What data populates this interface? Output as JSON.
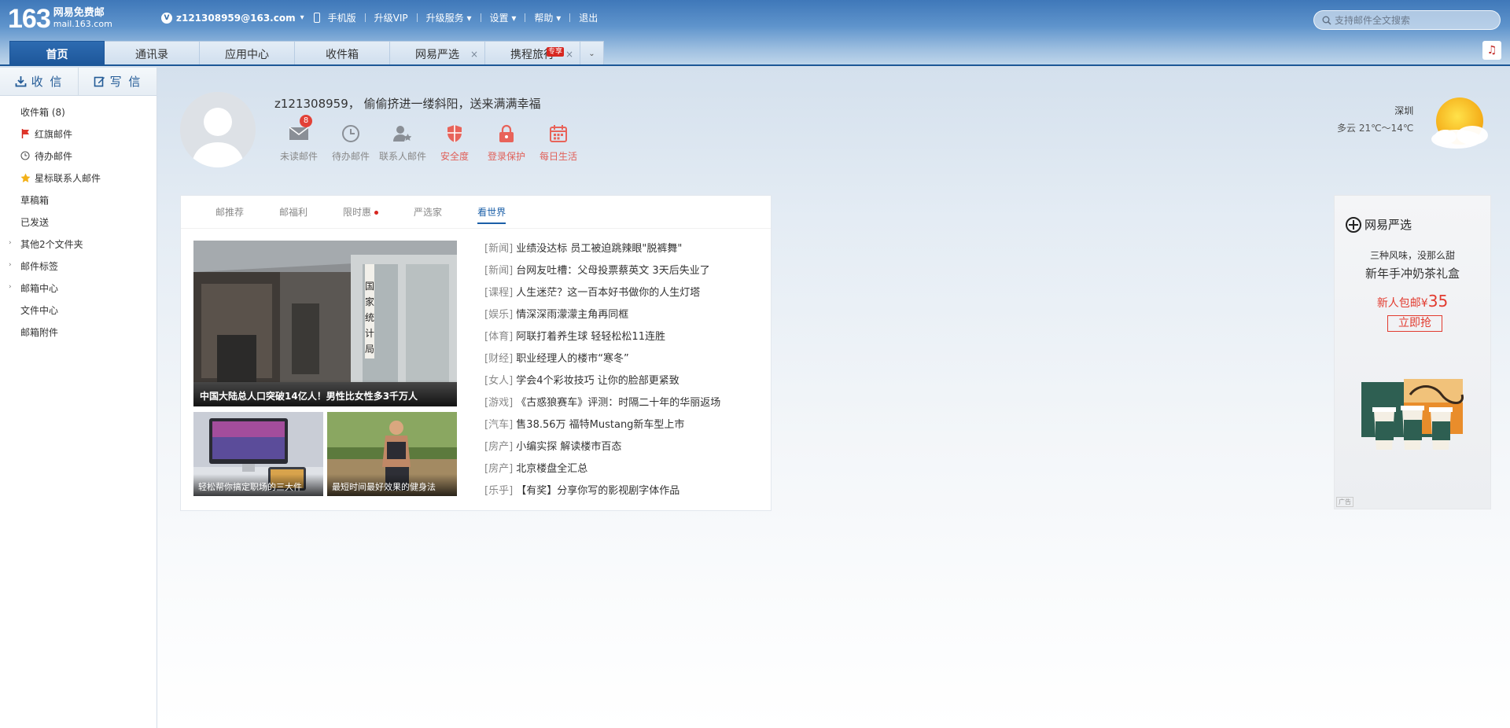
{
  "header": {
    "logo_num": "163",
    "logo_title": "网易免费邮",
    "logo_domain": "mail.163.com",
    "vip_letter": "V",
    "email": "z121308959@163.com",
    "nav": [
      "手机版",
      "升级VIP",
      "升级服务",
      "设置",
      "帮助",
      "退出"
    ],
    "search_placeholder": "支持邮件全文搜索"
  },
  "tabs": [
    {
      "label": "首页",
      "active": true
    },
    {
      "label": "通讯录"
    },
    {
      "label": "应用中心"
    },
    {
      "label": "收件箱"
    },
    {
      "label": "网易严选",
      "closable": true
    },
    {
      "label": "携程旅行",
      "closable": true,
      "badge": "专享"
    }
  ],
  "sidebar": {
    "receive": "收 信",
    "compose": "写 信",
    "folders": [
      {
        "label": "收件箱 (8)"
      },
      {
        "label": "红旗邮件",
        "icon": "red-flag-icon"
      },
      {
        "label": "待办邮件",
        "icon": "clock-icon"
      },
      {
        "label": "星标联系人邮件",
        "icon": "star-icon"
      },
      {
        "label": "草稿箱"
      },
      {
        "label": "已发送"
      },
      {
        "label": "其他2个文件夹",
        "expandable": true
      },
      {
        "label": "邮件标签",
        "expandable": true
      },
      {
        "label": "邮箱中心",
        "expandable": true
      },
      {
        "label": "文件中心"
      },
      {
        "label": "邮箱附件"
      }
    ]
  },
  "greeting": "z121308959， 偷偷挤进一缕斜阳，送来满满幸福",
  "quick": [
    {
      "label": "未读邮件",
      "badge": "8",
      "icon": "mail-icon"
    },
    {
      "label": "待办邮件",
      "icon": "clock-icon"
    },
    {
      "label": "联系人邮件",
      "icon": "contact-star-icon"
    },
    {
      "label": "安全度",
      "icon": "shield-icon",
      "red": true
    },
    {
      "label": "登录保护",
      "icon": "lock-icon",
      "red": true
    },
    {
      "label": "每日生活",
      "icon": "calendar-icon",
      "red": true
    }
  ],
  "weather": {
    "city": "深圳",
    "desc": "多云 21℃～14℃"
  },
  "panel": {
    "tabs": [
      {
        "label": "邮推荐"
      },
      {
        "label": "邮福利"
      },
      {
        "label": "限时惠",
        "dot": true
      },
      {
        "label": "严选家"
      },
      {
        "label": "看世界",
        "active": true
      }
    ],
    "big_caption": "中国大陆总人口突破14亿人！男性比女性多3千万人",
    "small1_caption": "轻松帮你搞定职场的三大件",
    "small2_caption": "最短时间最好效果的健身法",
    "news": [
      {
        "cat": "[新闻]",
        "title": "业绩没达标 员工被迫跳辣眼\"脱裤舞\""
      },
      {
        "cat": "[新闻]",
        "title": "台网友吐槽：父母投票蔡英文 3天后失业了"
      },
      {
        "cat": "[课程]",
        "title": "人生迷茫？这一百本好书做你的人生灯塔"
      },
      {
        "cat": "[娱乐]",
        "title": "情深深雨濛濛主角再同框"
      },
      {
        "cat": "[体育]",
        "title": "阿联打着养生球 轻轻松松11连胜"
      },
      {
        "cat": "[财经]",
        "title": "职业经理人的楼市“寒冬”"
      },
      {
        "cat": "[女人]",
        "title": "学会4个彩妆技巧 让你的脸部更紧致"
      },
      {
        "cat": "[游戏]",
        "title": "《古惑狼赛车》评测：时隔二十年的华丽返场"
      },
      {
        "cat": "[汽车]",
        "title": "售38.56万 福特Mustang新车型上市"
      },
      {
        "cat": "[房产]",
        "title": "小编实探 解读楼市百态"
      },
      {
        "cat": "[房产]",
        "title": "北京楼盘全汇总"
      },
      {
        "cat": "[乐乎]",
        "title": "【有奖】分享你写的影视剧字体作品"
      }
    ]
  },
  "ad": {
    "brand": "网易严选",
    "line1": "三种风味，没那么甜",
    "line2": "新年手冲奶茶礼盒",
    "price_prefix": "新人包邮¥",
    "price": "35",
    "button": "立即抢",
    "tag": "广告"
  }
}
